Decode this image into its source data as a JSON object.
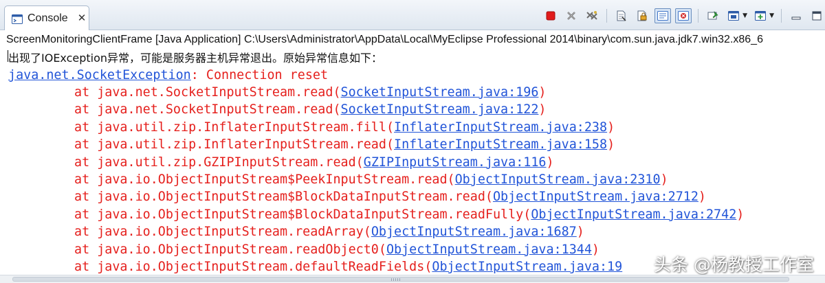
{
  "tab": {
    "label": "Console",
    "icon": "console-icon",
    "close_glyph": "✕"
  },
  "toolbar": {
    "buttons": [
      {
        "name": "terminate-icon",
        "color": "#e11b1b"
      },
      {
        "name": "remove-launch-icon",
        "color": "#7a7a7a"
      },
      {
        "name": "remove-all-terminated-icon",
        "color": "#7a7a7a"
      },
      {
        "name": "clear-console-icon",
        "color": "#5a6a80"
      },
      {
        "name": "scroll-lock-icon",
        "color": "#c98b1e"
      },
      {
        "name": "show-on-stdout-icon",
        "color": "#3f74c7"
      },
      {
        "name": "show-on-stderr-icon",
        "color": "#d12b2b"
      },
      {
        "name": "pin-console-icon",
        "color": "#2e9b3a"
      },
      {
        "name": "display-selected-console-icon",
        "color": "#2d5ca8"
      },
      {
        "name": "open-console-icon",
        "color": "#2d5ca8"
      }
    ]
  },
  "process_label": "ScreenMonitoringClientFrame [Java Application] C:\\Users\\Administrator\\AppData\\Local\\MyEclipse Professional 2014\\binary\\com.sun.java.jdk7.win32.x86_6",
  "console": {
    "message": "出现了IOException异常，可能是服务器主机异常退出。原始异常信息如下：",
    "exception_class": "java.net.SocketException",
    "exception_message": ": Connection reset",
    "frames": [
      {
        "at": "at java.net.SocketInputStream.read(",
        "link": "SocketInputStream.java:196",
        "close": ")"
      },
      {
        "at": "at java.net.SocketInputStream.read(",
        "link": "SocketInputStream.java:122",
        "close": ")"
      },
      {
        "at": "at java.util.zip.InflaterInputStream.fill(",
        "link": "InflaterInputStream.java:238",
        "close": ")"
      },
      {
        "at": "at java.util.zip.InflaterInputStream.read(",
        "link": "InflaterInputStream.java:158",
        "close": ")"
      },
      {
        "at": "at java.util.zip.GZIPInputStream.read(",
        "link": "GZIPInputStream.java:116",
        "close": ")"
      },
      {
        "at": "at java.io.ObjectInputStream$PeekInputStream.read(",
        "link": "ObjectInputStream.java:2310",
        "close": ")"
      },
      {
        "at": "at java.io.ObjectInputStream$BlockDataInputStream.read(",
        "link": "ObjectInputStream.java:2712",
        "close": ")"
      },
      {
        "at": "at java.io.ObjectInputStream$BlockDataInputStream.readFully(",
        "link": "ObjectInputStream.java:2742",
        "close": ")"
      },
      {
        "at": "at java.io.ObjectInputStream.readArray(",
        "link": "ObjectInputStream.java:1687",
        "close": ")"
      },
      {
        "at": "at java.io.ObjectInputStream.readObject0(",
        "link": "ObjectInputStream.java:1344",
        "close": ")"
      },
      {
        "at": "at java.io.ObjectInputStream.defaultReadFields(",
        "link": "ObjectInputStream.java:19",
        "close": ""
      }
    ]
  },
  "watermark": "头条 @杨教授工作室",
  "colors": {
    "error_text": "#e5201d",
    "link_text": "#2154d8",
    "plain_text": "#111111"
  }
}
